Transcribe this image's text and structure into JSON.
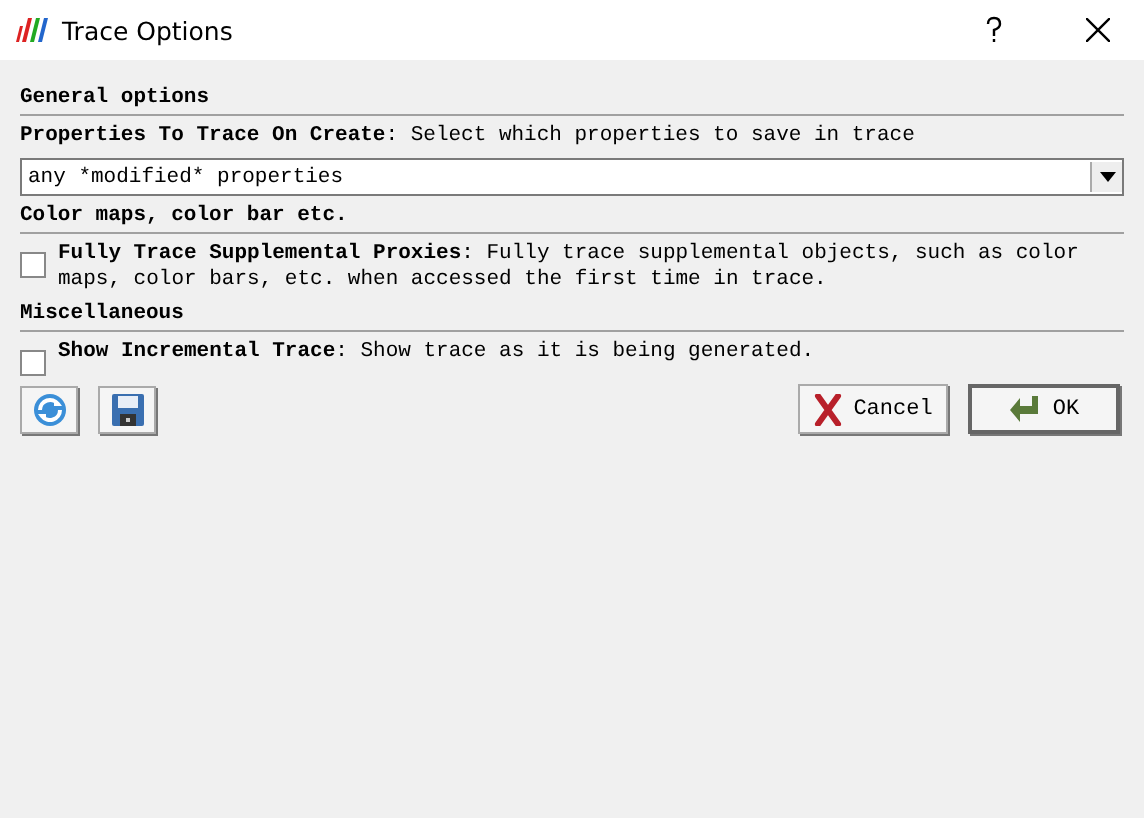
{
  "window": {
    "title": "Trace Options"
  },
  "sections": [
    {
      "title": "General options",
      "items": [
        {
          "kind": "combo",
          "text": "**Properties To Trace On Create**: Select which properties to save in trace",
          "value": "any *modified* properties"
        }
      ]
    },
    {
      "title": "Color maps, color bar etc.",
      "items": [
        {
          "kind": "checkbox",
          "checked": false,
          "text": "**Fully Trace Supplemental Proxies**: Fully trace supplemental objects, such as color maps, color bars, etc. when accessed the first time in trace."
        }
      ]
    },
    {
      "title": "Miscellaneous",
      "items": [
        {
          "kind": "checkbox",
          "checked": false,
          "text": "**Show Incremental Trace**: Show trace as it is being generated."
        }
      ]
    }
  ],
  "buttons": [
    {
      "label": "Cancel",
      "kind": "cancel"
    },
    {
      "label": "OK",
      "kind": "ok"
    }
  ]
}
